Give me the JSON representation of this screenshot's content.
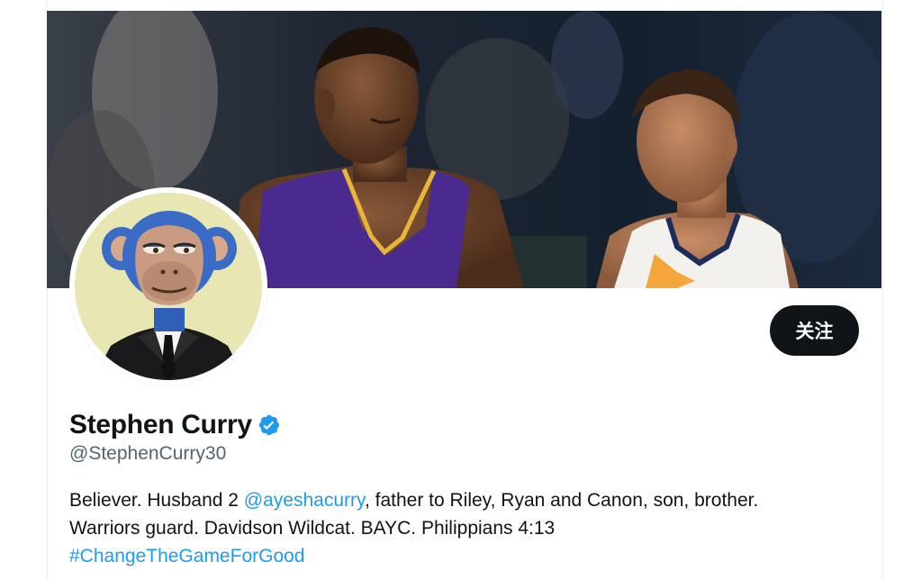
{
  "profile": {
    "display_name": "Stephen Curry",
    "handle": "@StephenCurry30",
    "verified": true,
    "follow_label": "关注",
    "bio": {
      "line1_before": "Believer. Husband 2 ",
      "line1_mention": "@ayeshacurry",
      "line1_after": ", father to Riley, Ryan and Canon, son, brother.",
      "line2": "Warriors guard. Davidson Wildcat. BAYC. Philippians 4:13",
      "line3_hashtag": "#ChangeTheGameForGood"
    }
  },
  "banner": {
    "description_icon": "banner-photo-icon"
  },
  "avatar": {
    "icon": "bored-ape-avatar-icon"
  },
  "colors": {
    "text_primary": "#0f1419",
    "text_secondary": "#536471",
    "link": "#1d9bf0",
    "button_bg": "#0f1419",
    "button_text": "#ffffff",
    "verified": "#1d9bf0"
  }
}
